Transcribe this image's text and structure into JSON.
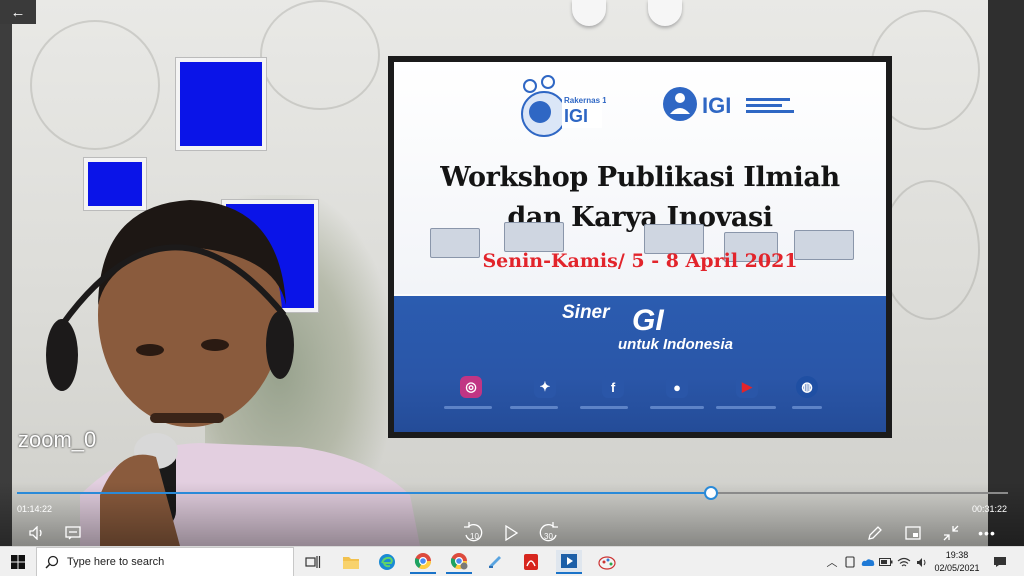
{
  "player": {
    "back_icon": "arrow-left-icon",
    "participant_name": "zoom_0",
    "elapsed_time": "01:14:22",
    "remaining_time": "00:31:22",
    "progress_fraction": 0.7,
    "controls": {
      "volume_icon": "volume-icon",
      "captions_icon": "captions-icon",
      "skip_back_label": "10",
      "play_icon": "play-icon",
      "skip_forward_label": "30",
      "edit_icon": "pen-icon",
      "miniplayer_icon": "miniplayer-icon",
      "fullscreen_icon": "collapse-icon",
      "more_icon": "more-icon"
    }
  },
  "slide": {
    "logo_left_text": [
      "Rakernas 1",
      "IGI"
    ],
    "logo_right_text": "IGI",
    "title_line1": "Workshop Publikasi Ilmiah",
    "title_line2": "dan Karya Inovasi",
    "date_text": "Senin-Kamis/ 5 - 8 April 2021",
    "bottom_brand_1": "Siner",
    "bottom_brand_igi": "GI",
    "bottom_brand_2": "untuk Indonesia",
    "social_icons": [
      "instagram-icon",
      "twitter-icon",
      "facebook-icon",
      "chat-icon",
      "youtube-icon",
      "globe-icon"
    ],
    "colors": {
      "accent_red": "#e2242b",
      "band_blue": "#2a56a8"
    }
  },
  "taskbar": {
    "search_placeholder": "Type here to search",
    "apps": [
      "task-view-icon",
      "file-explorer-icon",
      "edge-icon",
      "chrome-icon",
      "chrome-profile-icon",
      "notes-icon",
      "acrobat-icon",
      "media-player-icon",
      "paint-icon"
    ],
    "time": "19:38",
    "date": "02/05/2021"
  }
}
